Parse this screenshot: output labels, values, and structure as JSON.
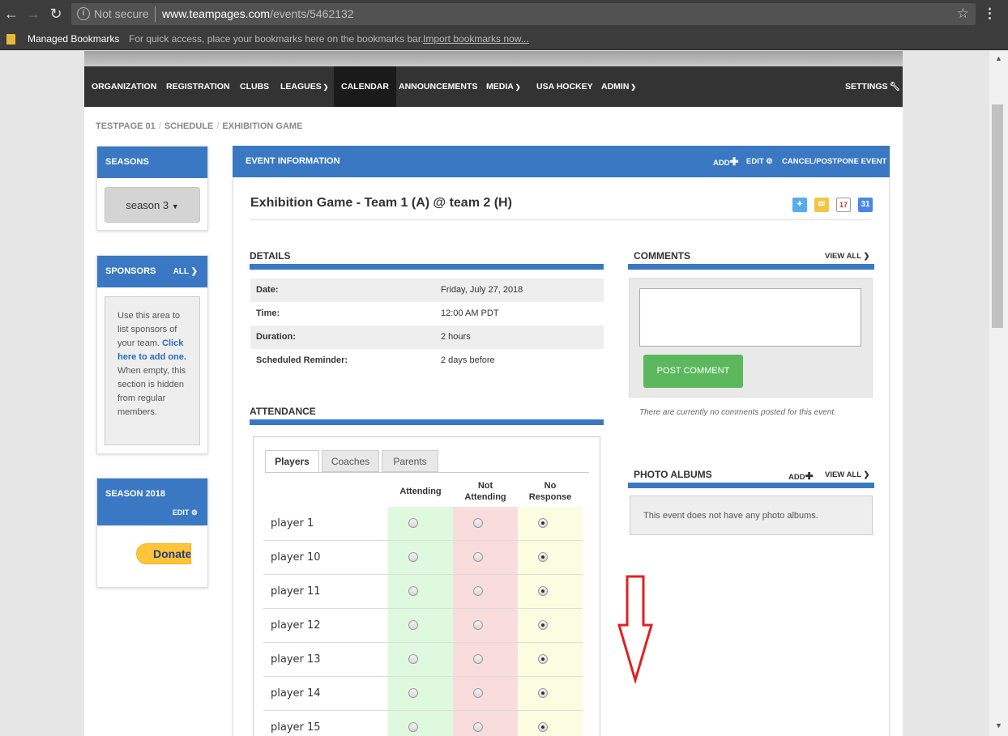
{
  "browser": {
    "security_label": "Not secure",
    "url_host": "www.teampages.com",
    "url_path": "/events/5462132",
    "bookmarks_folder": "Managed Bookmarks",
    "bookmarks_hint": "For quick access, place your bookmarks here on the bookmarks bar.",
    "bookmarks_import": "Import bookmarks now..."
  },
  "nav": {
    "items": [
      {
        "label": "ORGANIZATION"
      },
      {
        "label": "REGISTRATION"
      },
      {
        "label": "CLUBS"
      },
      {
        "label": "LEAGUES"
      },
      {
        "label": "CALENDAR"
      },
      {
        "label": "ANNOUNCEMENTS"
      },
      {
        "label": "MEDIA"
      },
      {
        "label": "USA HOCKEY"
      },
      {
        "label": "ADMIN"
      }
    ],
    "settings": "SETTINGS"
  },
  "breadcrumb": [
    "TESTPAGE 01",
    "SCHEDULE",
    "EXHIBITION GAME"
  ],
  "sidebar": {
    "seasons_title": "SEASONS",
    "season_selected": "season 3",
    "sponsors_title": "SPONSORS",
    "sponsors_all": "ALL",
    "sponsors_note_1": "Use this area to list sponsors of your team.",
    "sponsors_note_link": "Click here to add one.",
    "sponsors_note_2": "When empty, this section is hidden from regular members.",
    "season2018_title": "SEASON 2018",
    "season2018_edit": "EDIT",
    "donate_label": "Donate"
  },
  "event": {
    "header_title": "EVENT INFORMATION",
    "add": "ADD",
    "edit": "EDIT",
    "cancel": "CANCEL/POSTPONE EVENT",
    "title": "Exhibition Game - Team 1 (A) @ team 2 (H)",
    "calendar_day": "17",
    "gcal_day": "31"
  },
  "details": {
    "title": "DETAILS",
    "rows": [
      {
        "label": "Date:",
        "value": "Friday, July 27, 2018"
      },
      {
        "label": "Time:",
        "value": "12:00 AM PDT"
      },
      {
        "label": "Duration:",
        "value": "2 hours"
      },
      {
        "label": "Scheduled Reminder:",
        "value": "2 days before"
      }
    ]
  },
  "attendance": {
    "title": "ATTENDANCE",
    "tabs": [
      "Players",
      "Coaches",
      "Parents"
    ],
    "col_attending": "Attending",
    "col_not_attending_1": "Not",
    "col_not_attending_2": "Attending",
    "col_no_response_1": "No",
    "col_no_response_2": "Response",
    "players": [
      "player 1",
      "player 10",
      "player 11",
      "player 12",
      "player 13",
      "player 14",
      "player 15"
    ],
    "colors": {
      "attending": "#dff9df",
      "not_attending": "#f9dcdc",
      "no_response": "#fcfce0"
    }
  },
  "comments": {
    "title": "COMMENTS",
    "view_all": "VIEW ALL",
    "post_button": "POST COMMENT",
    "empty": "There are currently no comments posted for this event."
  },
  "photos": {
    "title": "PHOTO ALBUMS",
    "add": "ADD",
    "view_all": "VIEW ALL",
    "empty": "This event does not have any photo albums."
  }
}
